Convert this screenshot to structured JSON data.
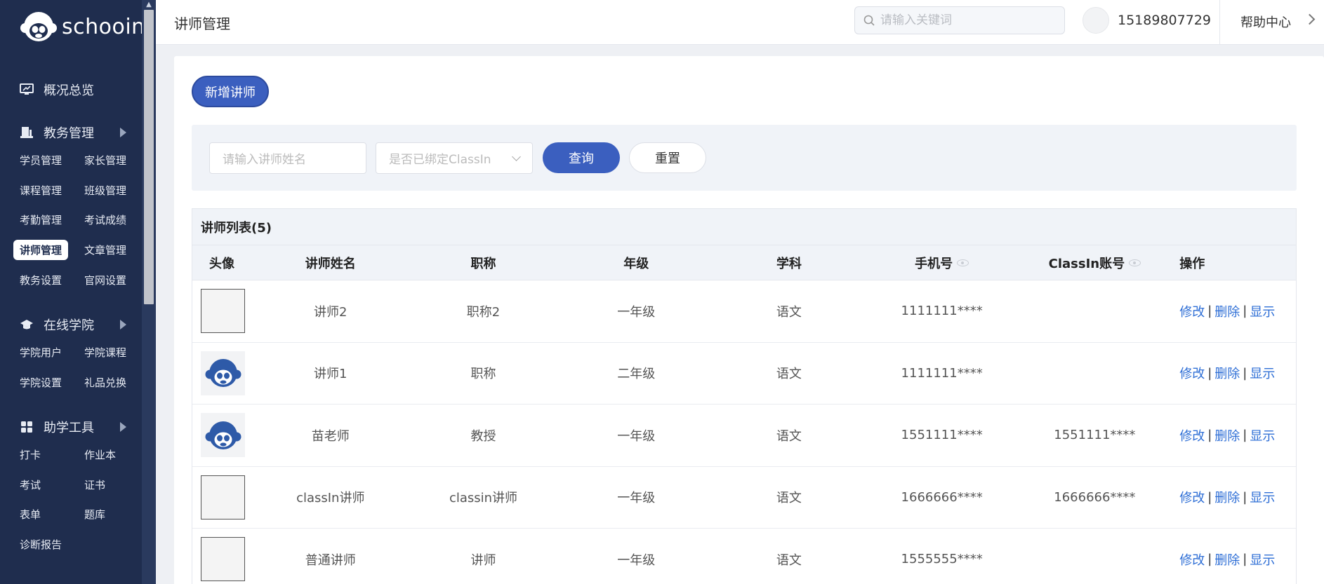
{
  "brand": {
    "name": "schooin"
  },
  "sidebar": {
    "sections": [
      {
        "label": "概况总览",
        "icon": "monitor-icon",
        "has_arrow": false,
        "items": []
      },
      {
        "label": "教务管理",
        "icon": "book-icon",
        "has_arrow": true,
        "items": [
          "学员管理",
          "家长管理",
          "课程管理",
          "班级管理",
          "考勤管理",
          "考试成绩",
          "讲师管理",
          "文章管理",
          "教务设置",
          "官网设置"
        ]
      },
      {
        "label": "在线学院",
        "icon": "graduation-cap-icon",
        "has_arrow": true,
        "items": [
          "学院用户",
          "学院课程",
          "学院设置",
          "礼品兑换"
        ]
      },
      {
        "label": "助学工具",
        "icon": "grid-icon",
        "has_arrow": true,
        "items": [
          "打卡",
          "作业本",
          "考试",
          "证书",
          "表单",
          "题库",
          "诊断报告"
        ]
      }
    ],
    "active_item": "讲师管理"
  },
  "header": {
    "title": "讲师管理",
    "search_placeholder": "请输入关键词",
    "phone": "15189807729",
    "help": "帮助中心"
  },
  "toolbar": {
    "add_label": "新增讲师"
  },
  "filters": {
    "name_placeholder": "请输入讲师姓名",
    "bind_placeholder": "是否已绑定ClassIn",
    "query_label": "查询",
    "reset_label": "重置"
  },
  "table": {
    "caption": "讲师列表(5)",
    "columns": [
      "头像",
      "讲师姓名",
      "职称",
      "年级",
      "学科",
      "手机号",
      "ClassIn账号",
      "操作"
    ],
    "rows": [
      {
        "avatar": "blank",
        "name": "讲师2",
        "title": "职称2",
        "grade": "一年级",
        "subject": "语文",
        "phone": "1111111****",
        "classin": ""
      },
      {
        "avatar": "mascot",
        "name": "讲师1",
        "title": "职称",
        "grade": "二年级",
        "subject": "语文",
        "phone": "1111111****",
        "classin": ""
      },
      {
        "avatar": "mascot",
        "name": "苗老师",
        "title": "教授",
        "grade": "一年级",
        "subject": "语文",
        "phone": "1551111****",
        "classin": "1551111****"
      },
      {
        "avatar": "blank",
        "name": "classIn讲师",
        "title": "classin讲师",
        "grade": "一年级",
        "subject": "语文",
        "phone": "1666666****",
        "classin": "1666666****"
      },
      {
        "avatar": "blank",
        "name": "普通讲师",
        "title": "讲师",
        "grade": "一年级",
        "subject": "语文",
        "phone": "1555555****",
        "classin": ""
      }
    ],
    "ops": {
      "edit": "修改",
      "delete": "删除",
      "show": "显示",
      "separator": "|"
    }
  }
}
